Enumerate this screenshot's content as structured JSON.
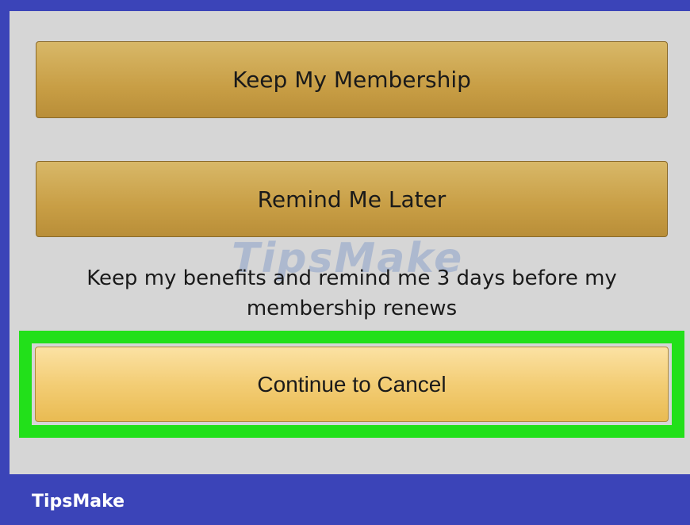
{
  "buttons": {
    "keep_label": "Keep My Membership",
    "remind_label": "Remind Me Later",
    "cancel_label": "Continue to Cancel"
  },
  "remind_description": "Keep my benefits and remind me 3 days before my membership renews",
  "watermark_text": "TipsMake",
  "footer": {
    "brand": "TipsMake"
  },
  "colors": {
    "frame": "#3b44b8",
    "screen_bg": "#d6d6d6",
    "highlight": "#22e01a",
    "primary_button": "#c89e45",
    "cancel_button": "#f3cd75"
  }
}
